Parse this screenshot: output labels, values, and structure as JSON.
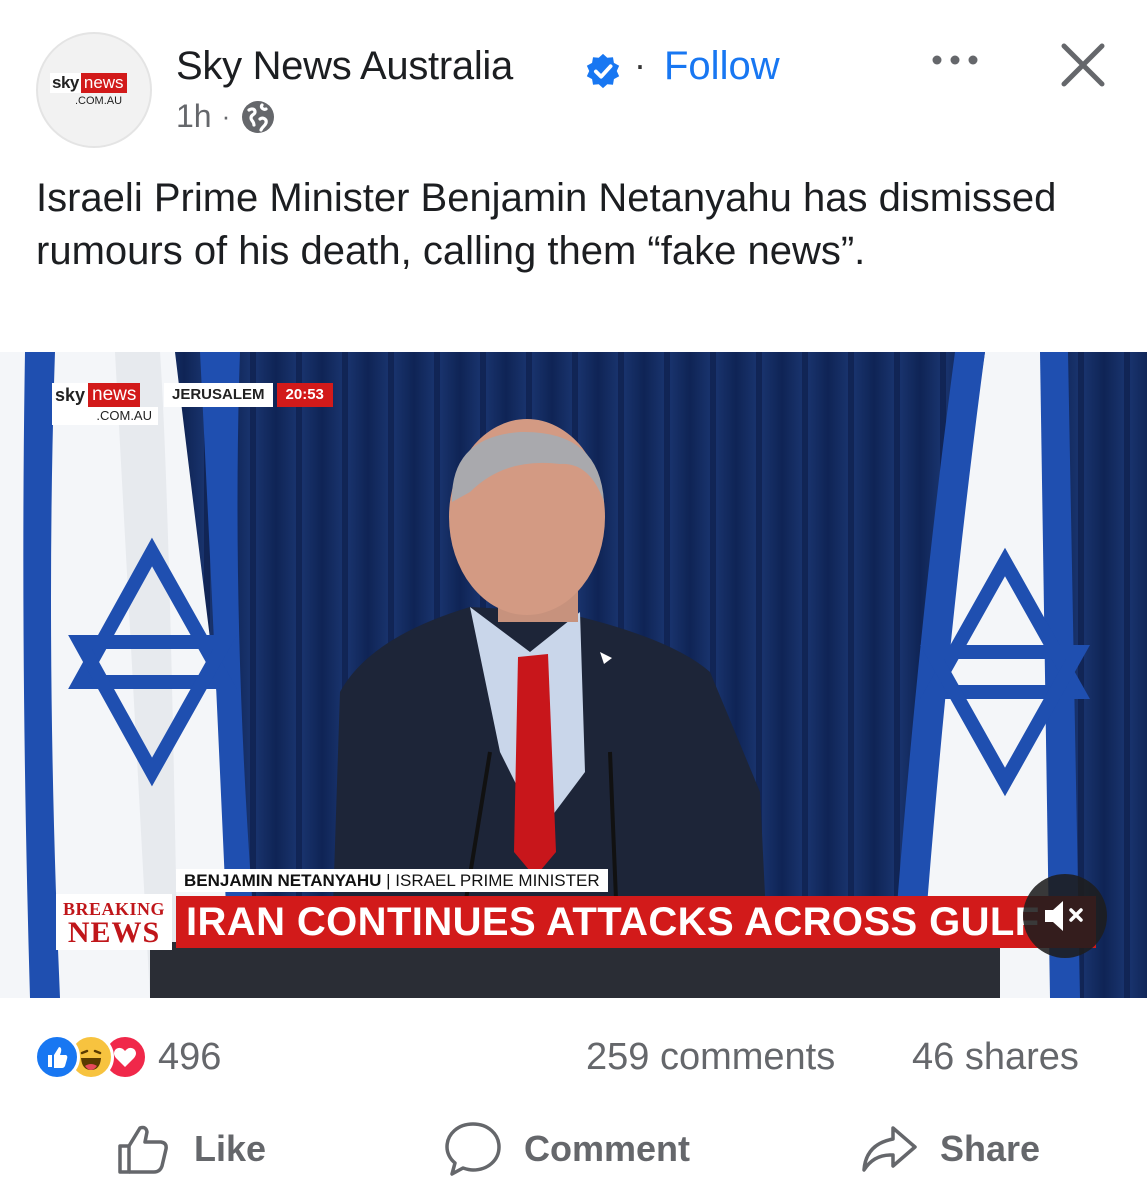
{
  "post": {
    "page_name": "Sky News Australia",
    "follow_label": "Follow",
    "time": "1h",
    "separator": "·",
    "text": "Israeli Prime Minister Benjamin Netanyahu has dismissed rumours of his death, calling them “fake news”."
  },
  "avatar_logo": {
    "sky": "sky",
    "news": "news",
    "domain": ".COM.AU"
  },
  "video": {
    "bug": {
      "sky": "sky",
      "news": "news",
      "domain": ".COM.AU",
      "location": "JERUSALEM",
      "time": "20:53"
    },
    "caption_name": "BENJAMIN NETANYAHU",
    "caption_sep": " | ",
    "caption_title": "ISRAEL PRIME MINISTER",
    "breaking_top": "BREAKING",
    "breaking_bottom": "NEWS",
    "headline": "IRAN CONTINUES ATTACKS ACROSS GULF"
  },
  "stats": {
    "reaction_count": "496",
    "comments": "259 comments",
    "shares": "46 shares"
  },
  "actions": {
    "like": "Like",
    "comment": "Comment",
    "share": "Share"
  },
  "icons": {
    "verified": "verified-badge-icon",
    "audience": "globe-icon",
    "more": "more-options-icon",
    "close": "close-icon",
    "mute": "muted-speaker-icon",
    "like_reaction": "like-reaction-icon",
    "haha_reaction": "haha-reaction-icon",
    "love_reaction": "love-reaction-icon"
  },
  "colors": {
    "link_blue": "#1877f2",
    "secondary_text": "#65676b",
    "sky_red": "#d21a1a",
    "flag_blue": "#1f4fb0"
  }
}
